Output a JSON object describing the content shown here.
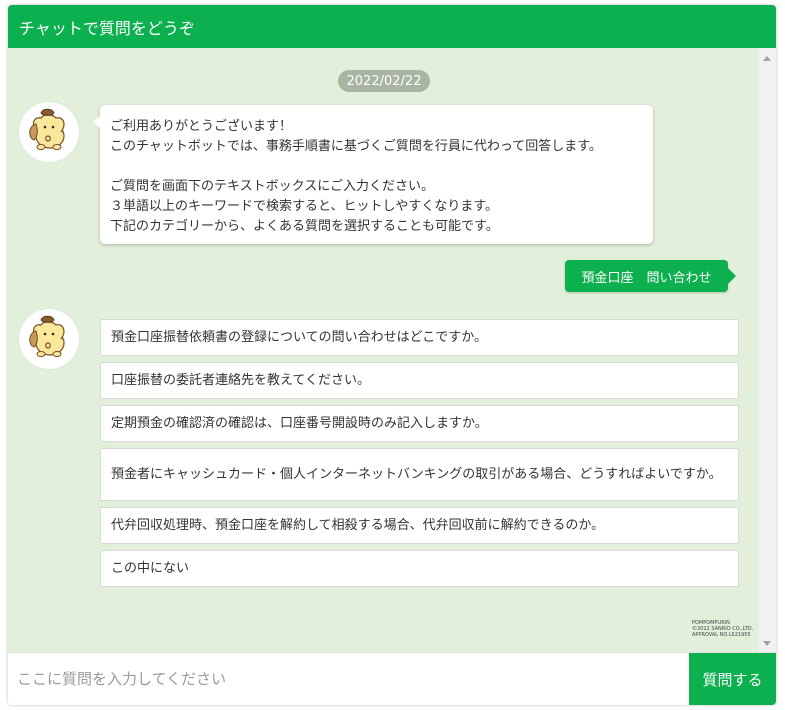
{
  "header": {
    "title": "チャットで質問をどうぞ"
  },
  "chat": {
    "date": "2022/02/22",
    "bot_message": {
      "lines_1": [
        "ご利用ありがとうございます！",
        "このチャットボットでは、事務手順書に基づくご質問を行員に代わって回答します。"
      ],
      "lines_2": [
        "ご質問を画面下のテキストボックスにご入力ください。",
        "３単語以上のキーワードで検索すると、ヒットしやすくなります。",
        "下記のカテゴリーから、よくある質問を選択することも可能です。"
      ]
    },
    "user_message": "預金口座　問い合わせ",
    "options": [
      "預金口座振替依頼書の登録についての問い合わせはどこですか。",
      "口座振替の委託者連絡先を教えてください。",
      "定期預金の確認済の確認は、口座番号開設時のみ記入しますか。",
      "預金者にキャッシュカード・個人インターネットバンキングの取引がある場合、どうすればよいですか。",
      "代弁回収処理時、預金口座を解約して相殺する場合、代弁回収前に解約できるのか。",
      "この中にない"
    ],
    "avatar_icon": "pompompurin-avatar-icon",
    "copyright_lines": [
      "POMPOMPURIN",
      "©2022 SANRIO CO.,LTD.",
      "APPROVAL NO.L621955"
    ]
  },
  "input": {
    "placeholder": "ここに質問を入力してください",
    "value": "",
    "send_label": "質問する"
  },
  "colors": {
    "accent": "#0cb04e",
    "chat_background": "#e2efda",
    "date_badge": "#a8b5a2"
  }
}
